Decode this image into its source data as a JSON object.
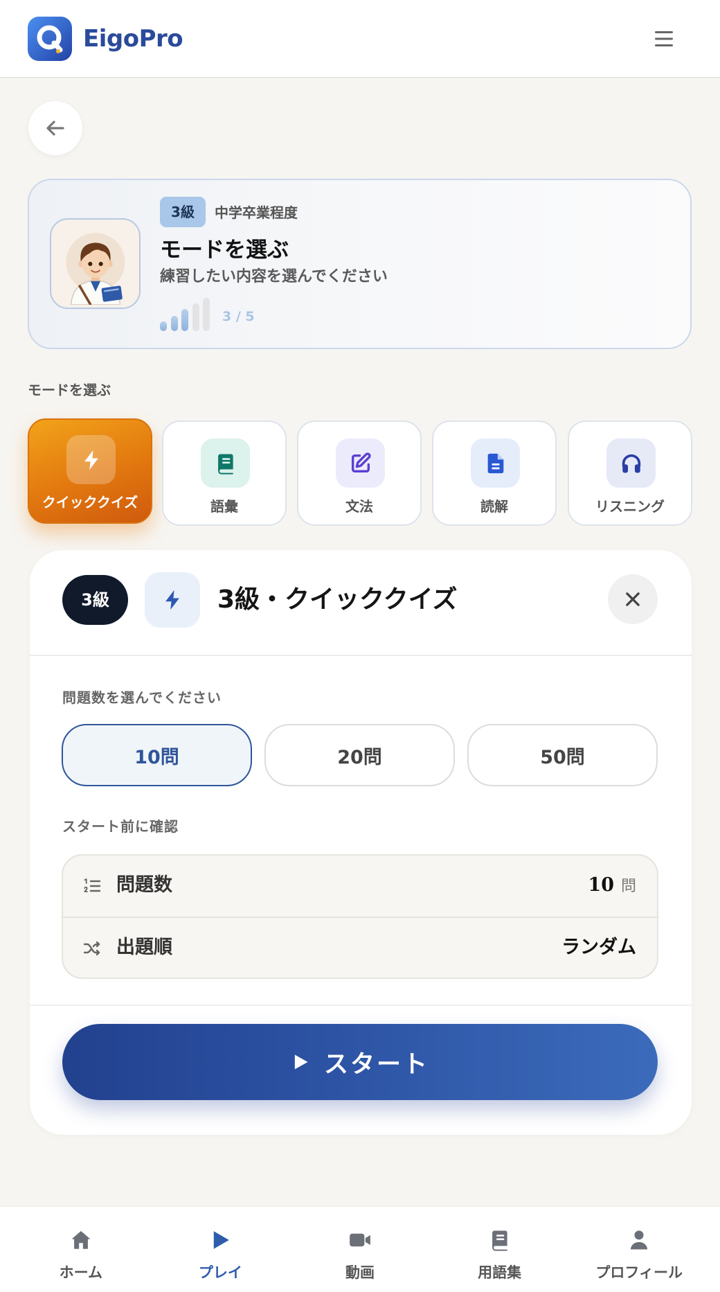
{
  "app": {
    "brand": "EigoPro",
    "logo_icon": "eigopro-logo-icon",
    "menu_icon": "hamburger-menu-icon"
  },
  "back_button": {
    "icon": "arrow-left-icon"
  },
  "hero": {
    "badge": "3級",
    "level": "中学卒業程度",
    "title": "モードを選ぶ",
    "subtitle": "練習したい内容を選んでください",
    "avatar_icon": "student-avatar-icon",
    "progress": {
      "label": "3 / 5",
      "filled": 3,
      "total": 5
    }
  },
  "modes": {
    "section_label": "モードを選ぶ",
    "items": [
      {
        "label": "クイッククイズ",
        "icon": "lightning-icon",
        "active": true
      },
      {
        "label": "語彙",
        "icon": "book-icon",
        "active": false
      },
      {
        "label": "文法",
        "icon": "pencil-square-icon",
        "active": false
      },
      {
        "label": "読解",
        "icon": "document-icon",
        "active": false
      },
      {
        "label": "リスニング",
        "icon": "headphones-icon",
        "active": false
      }
    ]
  },
  "quiz_panel": {
    "badge": "3級",
    "icon": "lightning-icon",
    "title": "3級・クイッククイズ",
    "close_icon": "close-icon",
    "count_prompt": "問題数を選んでください",
    "count_options": [
      "10問",
      "20問",
      "50問"
    ],
    "selected_count_index": 0,
    "confirm_label": "スタート前に確認",
    "summary": [
      {
        "icon": "list-ordered-icon",
        "label": "問題数",
        "value": "10",
        "unit": "問"
      },
      {
        "icon": "shuffle-icon",
        "label": "出題順",
        "value": "ランダム"
      }
    ],
    "start_icon": "play-icon",
    "start_label": "スタート"
  },
  "bottom_nav": {
    "items": [
      {
        "label": "ホーム",
        "icon": "home-icon",
        "active": false
      },
      {
        "label": "プレイ",
        "icon": "play-icon",
        "active": true
      },
      {
        "label": "動画",
        "icon": "video-camera-icon",
        "active": false
      },
      {
        "label": "用語集",
        "icon": "book-icon",
        "active": false
      },
      {
        "label": "プロフィール",
        "icon": "user-icon",
        "active": false
      }
    ]
  },
  "colors": {
    "brand": "#2a4a9b",
    "accent_orange": "#e2780f",
    "active_nav": "#2f5cab",
    "start_button": "#2e55a6"
  }
}
